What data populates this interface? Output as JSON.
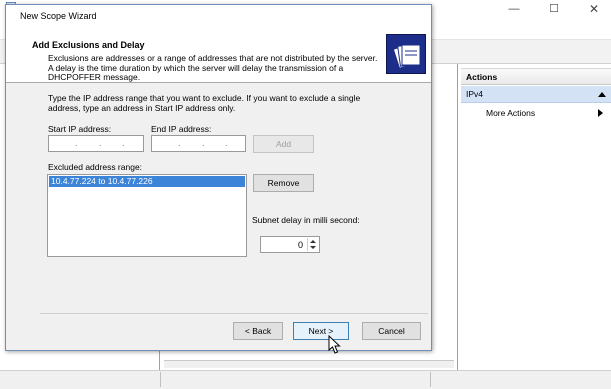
{
  "background_window": {
    "min_glyph": "—",
    "max_glyph": "☐",
    "close_glyph": "✕"
  },
  "actions_pane": {
    "header": "Actions",
    "section": "IPv4",
    "more_actions": "More Actions"
  },
  "wizard": {
    "title": "New Scope Wizard",
    "heading": "Add Exclusions and Delay",
    "description": "Exclusions are addresses or a range of addresses that are not distributed by the server. A delay is the time duration by which the server will delay the transmission of a DHCPOFFER message.",
    "instructions": "Type the IP address range that you want to exclude. If you want to exclude a single address, type an address in Start IP address only.",
    "start_ip_label": "Start IP address:",
    "end_ip_label": "End IP address:",
    "start_ip_value": "",
    "end_ip_value": "",
    "add_button": "Add",
    "excluded_label": "Excluded address range:",
    "excluded_ranges": [
      "10.4.77.224 to 10.4.77.226"
    ],
    "remove_button": "Remove",
    "subnet_delay_label": "Subnet delay in milli second:",
    "subnet_delay_value": "0",
    "back_button": "< Back",
    "next_button": "Next >",
    "cancel_button": "Cancel"
  },
  "colors": {
    "selection": "#3b84d8",
    "header_icon_bg": "#1c2d8a",
    "actions_selected_bg": "#d3e2f5"
  }
}
